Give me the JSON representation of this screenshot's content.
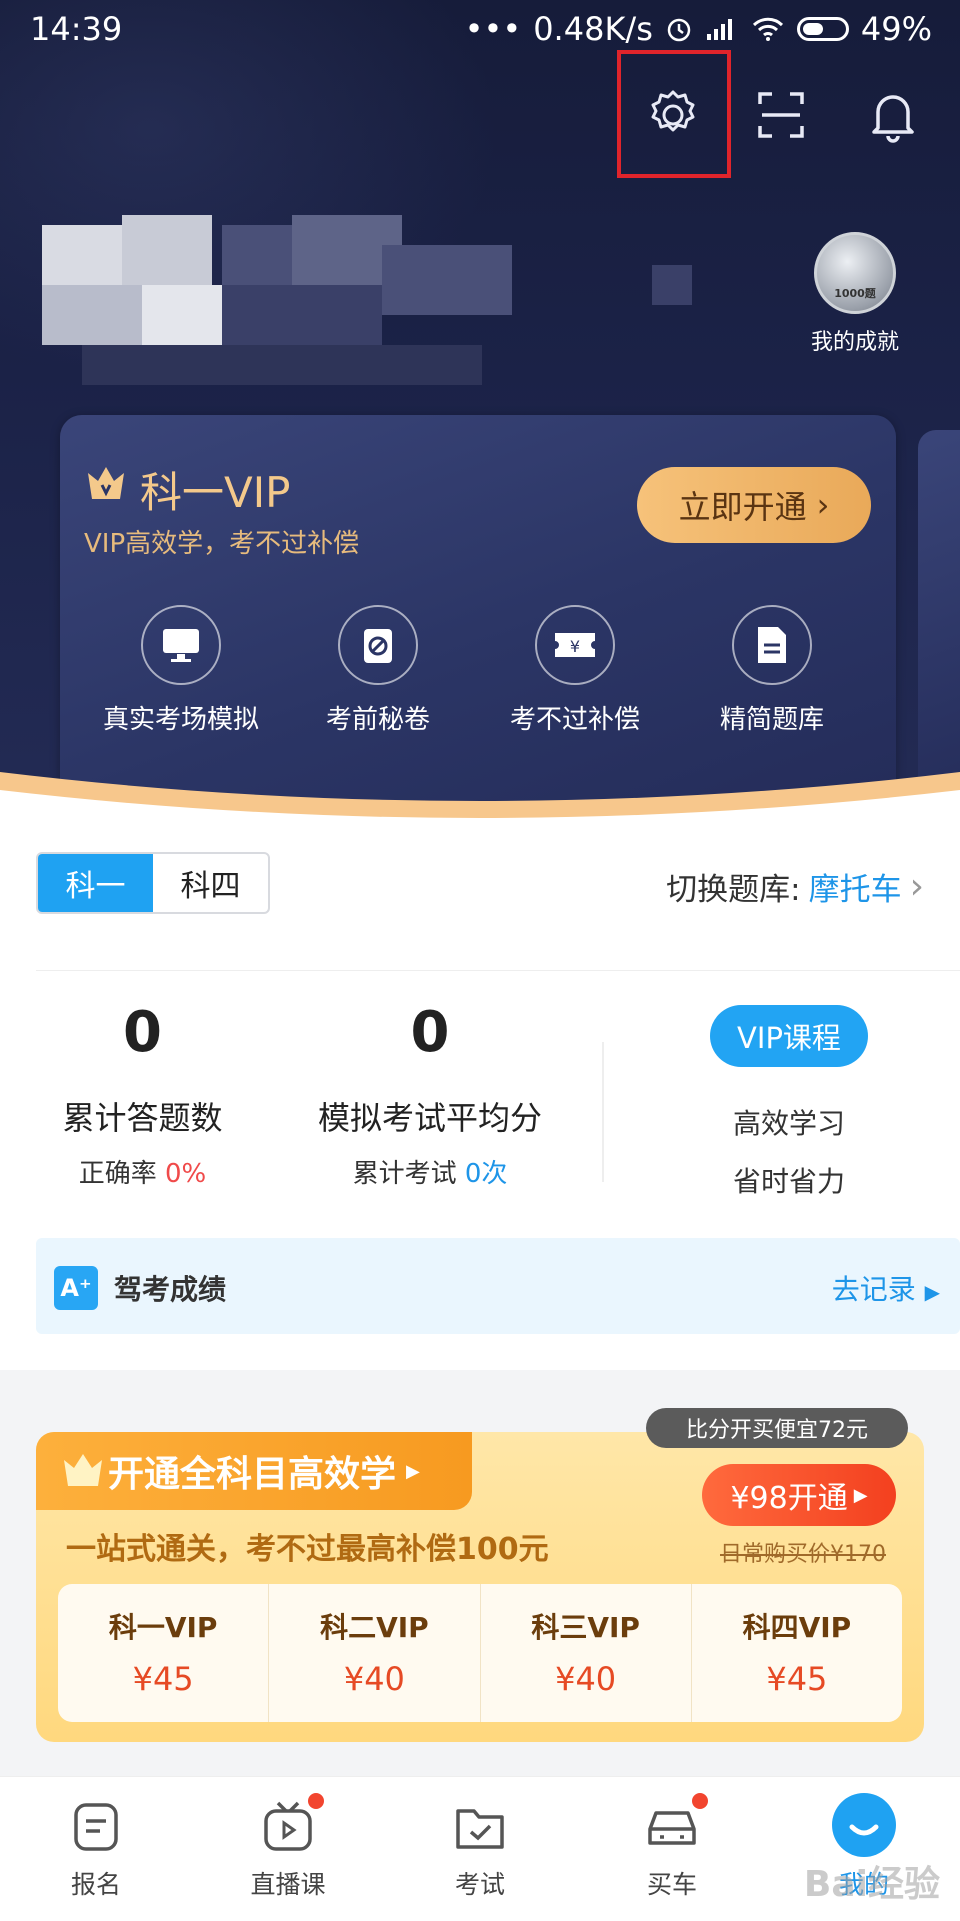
{
  "status_bar": {
    "time": "14:39",
    "dots": "•••",
    "speed": "0.48K/s",
    "battery": "49%"
  },
  "header": {
    "achievement_label": "我的成就",
    "medal_text": "1000题"
  },
  "vip_card": {
    "title": "科一VIP",
    "subtitle": "VIP高效学，考不过补偿",
    "button_label": "立即开通",
    "features": [
      "真实考场模拟",
      "考前秘卷",
      "考不过补偿",
      "精简题库"
    ]
  },
  "subject_tabs": {
    "items": [
      "科一",
      "科四"
    ],
    "selected": "科一"
  },
  "question_bank": {
    "label": "切换题库:",
    "value": "摩托车"
  },
  "stats": {
    "answered": {
      "value": "0",
      "label": "累计答题数",
      "sub_label": "正确率",
      "sub_value": "0%"
    },
    "mock_avg": {
      "value": "0",
      "label": "模拟考试平均分",
      "sub_label": "累计考试",
      "sub_value": "0次"
    },
    "vip_course": {
      "button": "VIP课程",
      "line1": "高效学习",
      "line2": "省时省力"
    }
  },
  "exam_score": {
    "icon_text": "A⁺",
    "label": "驾考成绩",
    "action": "去记录"
  },
  "promo": {
    "tab_title": "开通全科目高效学",
    "subtitle": "一站式通关，考不过最高补偿100元",
    "tip": "比分开买便宜72元",
    "buy_button": "¥98开通",
    "original_price": "日常购买价¥170",
    "items": [
      {
        "name": "科一VIP",
        "price": "¥45"
      },
      {
        "name": "科二VIP",
        "price": "¥40"
      },
      {
        "name": "科三VIP",
        "price": "¥40"
      },
      {
        "name": "科四VIP",
        "price": "¥45"
      }
    ]
  },
  "tabbar": {
    "items": [
      {
        "label": "报名",
        "icon": "form-icon"
      },
      {
        "label": "直播课",
        "icon": "live-tv-icon"
      },
      {
        "label": "考试",
        "icon": "exam-folder-icon"
      },
      {
        "label": "买车",
        "icon": "car-icon"
      },
      {
        "label": "我的",
        "icon": "profile-icon"
      }
    ],
    "active": "我的"
  },
  "watermark": "Bai经验",
  "colors": {
    "accent_blue": "#1fa2f2",
    "gold": "#f4c98b",
    "promo_red": "#f3401f",
    "highlight_red": "#e0242b"
  }
}
